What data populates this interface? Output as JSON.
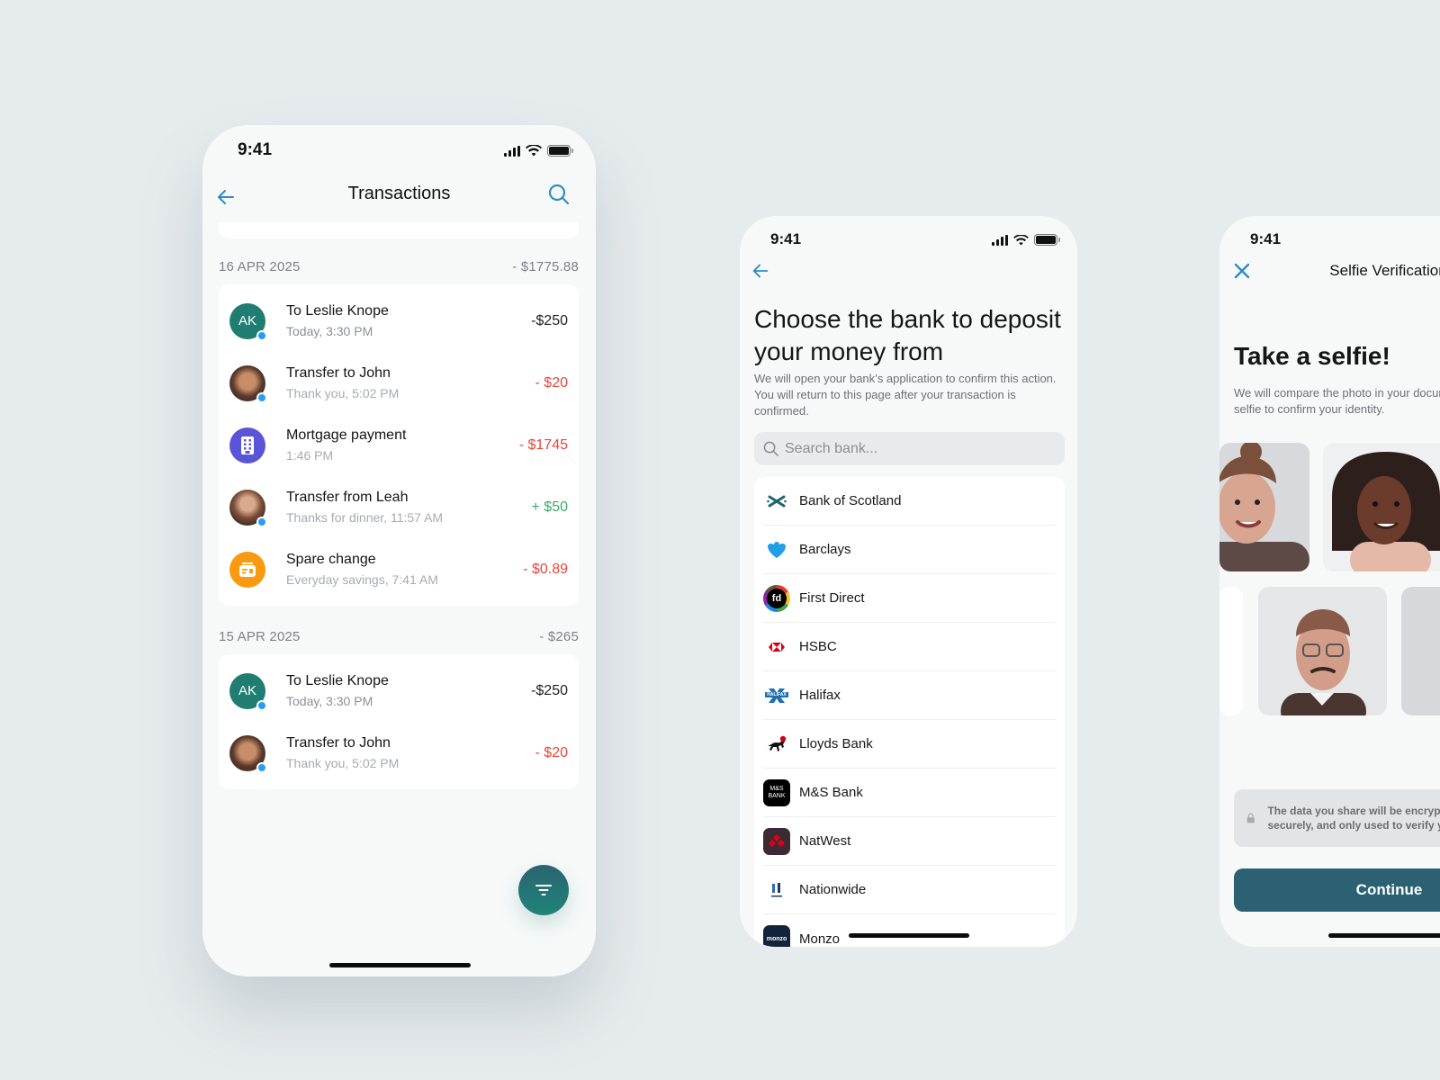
{
  "phones": {
    "transactions": {
      "status_time": "9:41",
      "title": "Transactions",
      "groups": [
        {
          "date": "16 APR 2025",
          "total": "- $1775.88",
          "items": [
            {
              "name": "To Leslie Knope",
              "sub": "Today, 3:30 PM",
              "amount": "-$250",
              "avatar_initials": "AK",
              "kind": "neutral"
            },
            {
              "name": "Transfer to John",
              "sub": "Thank you, 5:02 PM",
              "amount": "- $20",
              "kind": "negative"
            },
            {
              "name": "Mortgage payment",
              "sub": "1:46 PM",
              "amount": "- $1745",
              "kind": "negative"
            },
            {
              "name": "Transfer from Leah",
              "sub": "Thanks for dinner, 11:57 AM",
              "amount": "+ $50",
              "kind": "positive"
            },
            {
              "name": "Spare change",
              "sub": "Everyday savings, 7:41 AM",
              "amount": "- $0.89",
              "kind": "negative"
            }
          ]
        },
        {
          "date": "15 APR 2025",
          "total": "- $265",
          "items": [
            {
              "name": "To Leslie Knope",
              "sub": "Today, 3:30 PM",
              "amount": "-$250",
              "avatar_initials": "AK",
              "kind": "neutral"
            },
            {
              "name": "Transfer to John",
              "sub": "Thank you, 5:02 PM",
              "amount": "- $20",
              "kind": "negative"
            }
          ]
        }
      ],
      "icons": {
        "back": "arrow-left-icon",
        "search": "search-icon",
        "filter": "filter-icon"
      }
    },
    "bank_select": {
      "status_time": "9:41",
      "title": "Choose the bank to deposit your money from",
      "description": "We will open your bank’s application to confirm this action. You will return to this page after your transaction is confirmed.",
      "search_placeholder": "Search bank...",
      "banks": [
        "Bank of Scotland",
        "Barclays",
        "First Direct",
        "HSBC",
        "Halifax",
        "Lloyds Bank",
        "M&S Bank",
        "NatWest",
        "Nationwide",
        "Monzo"
      ],
      "logo_text": {
        "first_direct": "fd",
        "ms": "M&S BANK",
        "halifax": "HALIFAX",
        "monzo": "monzo"
      }
    },
    "selfie": {
      "status_time": "9:41",
      "title": "Selfie Verification",
      "heading": "Take a selfie!",
      "description": "We will compare the photo in your document with your selfie to confirm your identity.",
      "note": "The data you share will be encrypted, stored securely, and only used to verify your identity.",
      "continue_label": "Continue"
    }
  },
  "colors": {
    "accent_blue": "#2f8bc6",
    "teal": "#1f7d72",
    "button": "#2b6173",
    "negative": "#e8463a",
    "positive": "#3da76a"
  }
}
